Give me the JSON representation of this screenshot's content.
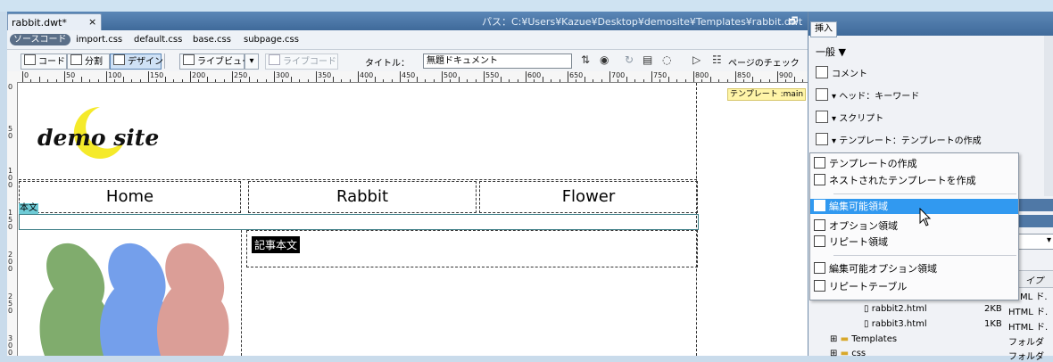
{
  "document": {
    "tab_title": "rabbit.dwt*",
    "tab_close": "×",
    "path": "パス：C:¥Users¥Kazue¥Desktop¥demosite¥Templates¥rabbit.dwt",
    "restore_glyph": "🗗"
  },
  "related_files": {
    "source_button": "ソースコード",
    "files": [
      "import.css",
      "default.css",
      "base.css",
      "subpage.css"
    ]
  },
  "toolbar": {
    "code": "コード",
    "split": "分割",
    "design": "デザイン",
    "live_view": "ライブビュー",
    "live_code": "ライブコード",
    "title_label": "タイトル：",
    "title_value": "無題ドキュメント",
    "check_page": "ページのチェック"
  },
  "ruler": {
    "h_labels": [
      "0",
      "50",
      "100",
      "150",
      "200",
      "250",
      "300",
      "350",
      "400",
      "450",
      "500",
      "550",
      "600",
      "650",
      "700",
      "750",
      "800",
      "850",
      "900"
    ],
    "v_labels": [
      "0",
      "50",
      "100",
      "150",
      "200",
      "250",
      "300"
    ]
  },
  "canvas": {
    "template_tag": "テンプレート :main",
    "logo": "demo site",
    "nav": [
      "Home",
      "Rabbit",
      "Flower"
    ],
    "body_tag": "本文",
    "article_label": "記事本文",
    "colors": {
      "moon": "#f5ea2a",
      "rabbit_green": "#6a9e54",
      "rabbit_blue": "#5c8fe8",
      "rabbit_pink": "#d58e86"
    }
  },
  "panel": {
    "tab": "挿入",
    "category": "一般 ▼",
    "items": [
      {
        "label": "コメント",
        "icon": "comment-icon"
      },
      {
        "label": "▾ ヘッド：キーワード",
        "icon": "head-icon"
      },
      {
        "label": "▾ スクリプト",
        "icon": "script-icon"
      },
      {
        "label": "▾ テンプレート：テンプレートの作成",
        "icon": "template-icon"
      }
    ]
  },
  "menu": {
    "items": [
      {
        "label": "テンプレートの作成",
        "icon": "template-icon"
      },
      {
        "label": "ネストされたテンプレートを作成",
        "icon": "nested-template-icon"
      },
      {
        "label": "編集可能領域",
        "icon": "editable-region-icon",
        "highlighted": true
      },
      {
        "label": "オプション領域",
        "icon": "optional-region-icon"
      },
      {
        "label": "リピート領域",
        "icon": "repeat-region-icon"
      },
      {
        "label": "編集可能オプション領域",
        "icon": "editable-optional-region-icon"
      },
      {
        "label": "リピートテーブル",
        "icon": "repeat-table-icon"
      }
    ]
  },
  "files": {
    "col_hint": "イプ",
    "rows": [
      {
        "name": "",
        "size": "",
        "type": "ML ド."
      },
      {
        "name": "rabbit2.html",
        "size": "2KB",
        "type": "HTML ド."
      },
      {
        "name": "rabbit3.html",
        "size": "1KB",
        "type": "HTML ド."
      },
      {
        "name": "Templates",
        "size": "",
        "type": "フォルダ"
      },
      {
        "name": "css",
        "size": "",
        "type": "フォルダ"
      }
    ]
  }
}
